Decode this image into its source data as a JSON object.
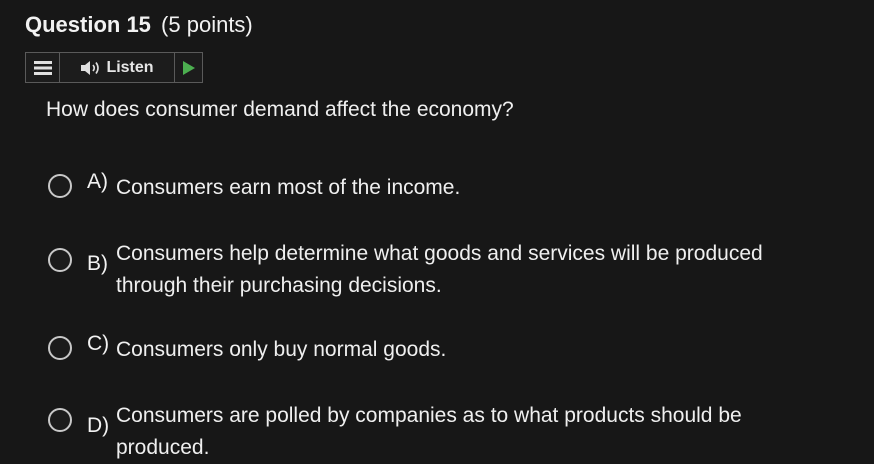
{
  "question": {
    "title": "Question 15",
    "points": "(5 points)",
    "text": "How does consumer demand affect the economy?"
  },
  "toolbar": {
    "menu_icon": "menu-icon",
    "speaker_icon": "speaker-icon",
    "listen_label": "Listen",
    "play_icon": "play-icon",
    "play_color": "#4caf50"
  },
  "options": [
    {
      "letter": "A)",
      "text": "Consumers earn most of the income."
    },
    {
      "letter": "B)",
      "text": "Consumers help determine what goods and services will be produced through their purchasing decisions."
    },
    {
      "letter": "C)",
      "text": "Consumers only buy normal goods."
    },
    {
      "letter": "D)",
      "text": "Consumers are polled by companies as to what products should be produced."
    }
  ]
}
